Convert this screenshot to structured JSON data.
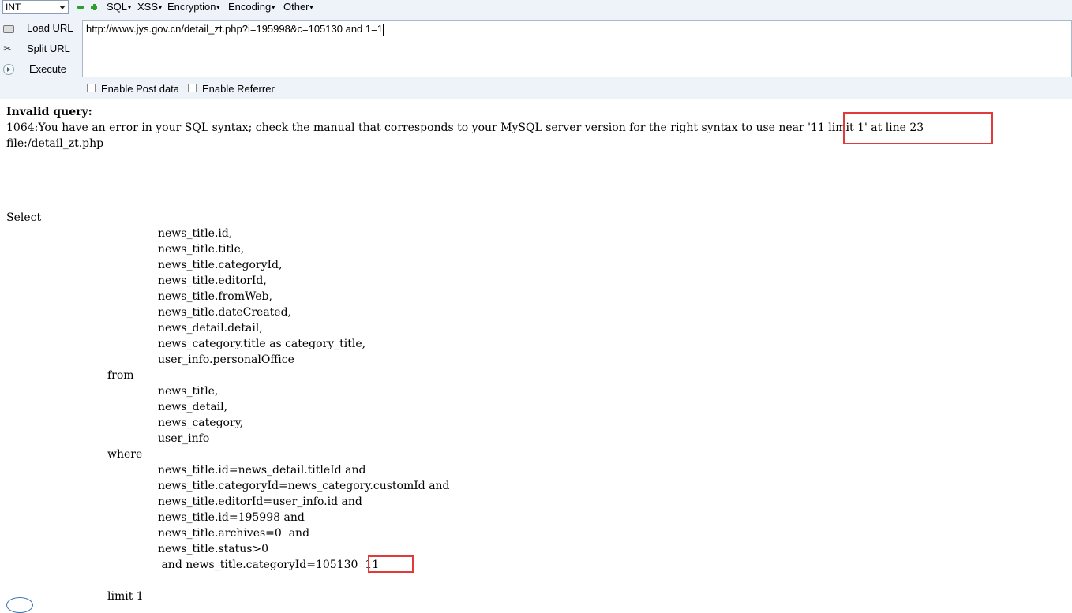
{
  "toolbar": {
    "type_select": "INT",
    "menus": [
      "SQL",
      "XSS",
      "Encryption",
      "Encoding",
      "Other"
    ],
    "load_url": "Load URL",
    "split_url": "Split URL",
    "execute": "Execute",
    "url_value": "http://www.jys.gov.cn/detail_zt.php?i=195998&c=105130 and 1=1",
    "enable_post": "Enable Post data",
    "enable_referrer": "Enable Referrer"
  },
  "error": {
    "title": "Invalid query:",
    "message": "1064:You have an error in your SQL syntax; check the manual that corresponds to your MySQL server version for the right syntax to use near '11 limit 1' at line 23",
    "file": "file:/detail_zt.php"
  },
  "sql": [
    "Select",
    "news_title.id,",
    "news_title.title,",
    "news_title.categoryId,",
    "news_title.editorId,",
    "news_title.fromWeb,",
    "news_title.dateCreated,",
    "news_detail.detail,",
    "news_category.title as category_title,",
    "user_info.personalOffice",
    "from",
    "news_title,",
    "news_detail,",
    "news_category,",
    "user_info",
    "where",
    "news_title.id=news_detail.titleId and",
    "news_title.categoryId=news_category.customId and",
    "news_title.editorId=user_info.id and",
    "news_title.id=195998 and",
    "news_title.archives=0  and",
    "news_title.status>0",
    " and news_title.categoryId=105130  11",
    "limit 1"
  ],
  "colors": {
    "highlight": "#e03a3a",
    "toolbar_bg": "#eef3fa"
  }
}
